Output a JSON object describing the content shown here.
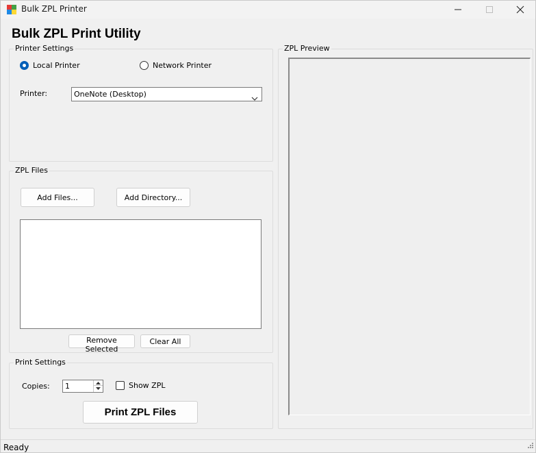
{
  "window": {
    "title": "Bulk ZPL Printer",
    "minimize_icon": "minimize-icon",
    "maximize_icon": "maximize-icon",
    "close_icon": "close-icon"
  },
  "app": {
    "heading": "Bulk ZPL Print Utility"
  },
  "printer_settings": {
    "group_label": "Printer Settings",
    "local_label": "Local Printer",
    "local_checked": true,
    "network_label": "Network Printer",
    "network_checked": false,
    "printer_label": "Printer:",
    "printer_value": "OneNote (Desktop)"
  },
  "zpl_files": {
    "group_label": "ZPL Files",
    "add_files_label": "Add Files...",
    "add_directory_label": "Add Directory...",
    "files": [],
    "remove_selected_label": "Remove Selected",
    "clear_all_label": "Clear All"
  },
  "print_settings": {
    "group_label": "Print Settings",
    "copies_label": "Copies:",
    "copies_value": "1",
    "show_zpl_label": "Show ZPL",
    "show_zpl_checked": false,
    "print_button_label": "Print ZPL Files"
  },
  "preview": {
    "group_label": "ZPL Preview",
    "content": ""
  },
  "status": {
    "text": "Ready"
  },
  "colors": {
    "accent": "#005fb8",
    "window_bg": "#f0f0f0"
  }
}
